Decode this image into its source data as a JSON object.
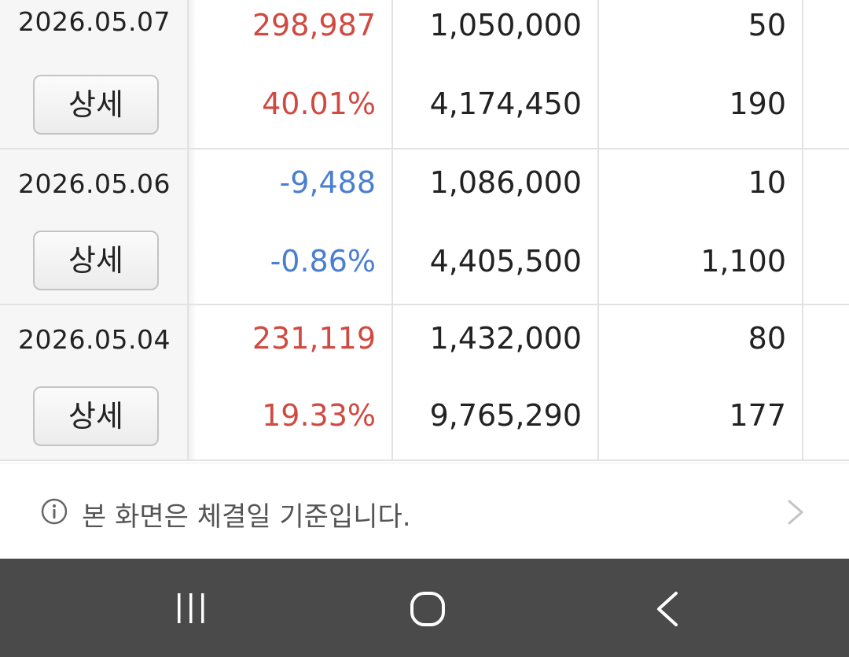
{
  "rows": [
    {
      "date": "2026.05.07",
      "detail_label": "상세",
      "change": "298,987",
      "change_rate": "40.01%",
      "trend": "up",
      "price_top": "1,050,000",
      "price_bottom": "4,174,450",
      "qty_top": "50",
      "qty_bottom": "190"
    },
    {
      "date": "2026.05.06",
      "detail_label": "상세",
      "change": "-9,488",
      "change_rate": "-0.86%",
      "trend": "down",
      "price_top": "1,086,000",
      "price_bottom": "4,405,500",
      "qty_top": "10",
      "qty_bottom": "1,100"
    },
    {
      "date": "2026.05.04",
      "detail_label": "상세",
      "change": "231,119",
      "change_rate": "19.33%",
      "trend": "up",
      "price_top": "1,432,000",
      "price_bottom": "9,765,290",
      "qty_top": "80",
      "qty_bottom": "177"
    }
  ],
  "notice": {
    "text": "본 화면은 체결일 기준입니다.",
    "icon": "info-icon"
  },
  "colors": {
    "up": "#d04a42",
    "down": "#4a7fd0"
  },
  "navbar": {
    "icons": [
      "recent-apps-icon",
      "home-icon",
      "back-icon"
    ]
  }
}
